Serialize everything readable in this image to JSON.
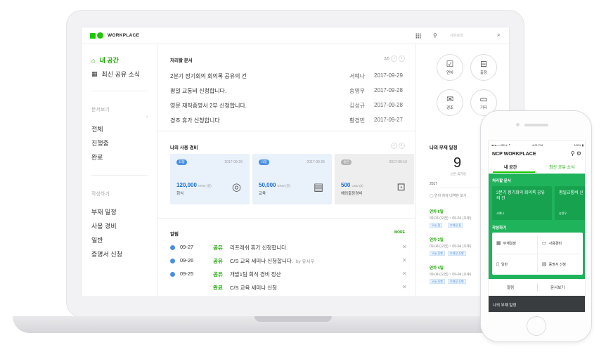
{
  "app": {
    "logo_text": "WORKPLACE",
    "search_placeholder": "사원검색",
    "brand_color": "#1ec800",
    "accent_blue": "#4a8fe3"
  },
  "sidebar": {
    "main_items": [
      {
        "label": "내 공간",
        "icon": "home-icon",
        "active": true
      },
      {
        "label": "최신 공유 소식",
        "icon": "grid-icon",
        "active": false
      }
    ],
    "sections": [
      {
        "title": "문서보기",
        "items": [
          "전체",
          "진행중",
          "완료"
        ]
      },
      {
        "title": "작성하기",
        "items": [
          "부재 일정",
          "사용 경비",
          "일반",
          "증명서 신청"
        ]
      }
    ]
  },
  "docs": {
    "title": "처리할 문서",
    "pager": "2/5",
    "rows": [
      {
        "title": "2분기 정기회의 회의록 공유의 건",
        "name": "서예나",
        "date": "2017-09-29"
      },
      {
        "title": "평일 교통비 신청합니다.",
        "name": "송명우",
        "date": "2017-09-28"
      },
      {
        "title": "영문 재직증명서 2부 신청합니다.",
        "name": "김성규",
        "date": "2017-09-28"
      },
      {
        "title": "경조 휴가 신청합니다",
        "name": "황경민",
        "date": "2017-09-27"
      }
    ]
  },
  "expenses": {
    "title": "나의 사용 경비",
    "cards": [
      {
        "badge": "요청",
        "date": "2017-09-26",
        "amount": "120,000",
        "unit": "KRW (원)",
        "category": "회식",
        "icon": "dining-icon"
      },
      {
        "badge": "요청",
        "date": "2017-09-25",
        "amount": "50,000",
        "unit": "KRW (원)",
        "category": "교육",
        "icon": "book-icon"
      },
      {
        "badge": "승인",
        "date": "2017-09-10",
        "amount": "500",
        "unit": "USD ($)",
        "category": "해외출장경비",
        "icon": "briefcase-icon"
      }
    ]
  },
  "notices": {
    "title": "알림",
    "more": "MORE",
    "rows": [
      {
        "date": "09-27",
        "type": "공유",
        "text": "리프레쉬 휴가 신청합니다.",
        "by": ""
      },
      {
        "date": "09-26",
        "type": "공유",
        "text": "C/S 교육 세미나 신청합니다.",
        "by": "by 유서우"
      },
      {
        "date": "09-25",
        "type": "공유",
        "text": "개발1팀 회식 경비 정산",
        "by": ""
      },
      {
        "date": "",
        "type": "완료",
        "text": "C/S 교육 세미나 신청",
        "by": ""
      }
    ]
  },
  "quick_actions": [
    {
      "label": "연차",
      "icon": "calendar-check-icon"
    },
    {
      "label": "출장",
      "icon": "luggage-icon"
    },
    {
      "label": "경조",
      "icon": "envelope-icon"
    },
    {
      "label": "기타",
      "icon": "calendar-icon"
    }
  ],
  "absence": {
    "title": "나의 부재 일정",
    "count": "9",
    "count_label": "남은 휴가일",
    "year": "2017",
    "note": "연차 차감 내역만 보기",
    "entries": [
      {
        "type": "연차 6일",
        "range": "09-04 (오전) ~ 09-04 (오후)",
        "tags": [
          "오늘 할",
          "부재정 중"
        ]
      },
      {
        "type": "연차 2일",
        "range": "09-04 (오전) ~ 09-04 (오후)",
        "tags": [
          "오늘 진행",
          "부재정 진행"
        ]
      },
      {
        "type": "연차 4일",
        "range": "09-04 (오전) ~ 09-04 (오후)",
        "tags": [
          "오늘 진행",
          "부재정 진행"
        ]
      }
    ]
  },
  "mobile": {
    "status_left": "●●●○○ BELL ⇡",
    "status_time": "4:21 PM",
    "status_right": "100% ▮",
    "title": "NCP WORKPLACE",
    "tabs": [
      "내 공간",
      "최신 공유 소식"
    ],
    "docs_title": "처리할 문서",
    "cards": [
      {
        "title": "2분기 정기회의 회의록 공유의 건",
        "name": "서예나"
      },
      {
        "title": "평일교통비 신",
        "name": "송명우"
      }
    ],
    "write_title": "작성하기",
    "write_items": [
      {
        "label": "부재일정",
        "icon": "calendar-icon"
      },
      {
        "label": "사용경비",
        "icon": "card-icon"
      },
      {
        "label": "일반",
        "icon": "document-icon"
      },
      {
        "label": "증명서 신청",
        "icon": "certificate-icon"
      }
    ],
    "bottom_tabs": [
      "알림",
      "문서보기"
    ],
    "bottom_section": "나의 부재 일정"
  }
}
